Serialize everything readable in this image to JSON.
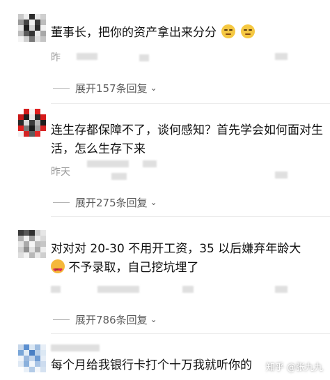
{
  "comments": [
    {
      "text": "董事长，把你的资产拿出来分分",
      "time": "昨",
      "replies_label": "展开157条回复",
      "avatar_colors": [
        "#c9c9c9",
        "#eeeeee",
        "#2c2c2c",
        "#e8e8e8",
        "#cfcfcf",
        "#9a9a9a",
        "#444444",
        "#f0f0f0",
        "#3a3a3a",
        "#bdbdbd",
        "#e5e5e5",
        "#1f1f1f",
        "#d6d6d6",
        "#2a2a2a",
        "#f2f2f2",
        "#bcbcbc",
        "#5a5a5a",
        "#333333",
        "#e9e9e9",
        "#a8a8a8",
        "#f4f4f4",
        "#cfcfcf",
        "#777777",
        "#dedede",
        "#c4c4c4"
      ]
    },
    {
      "text": "连生存都保障不了，谈何感知？首先学会如何面对生活，怎么生存下来",
      "time": "昨天",
      "replies_label": "展开275条回复",
      "avatar_colors": [
        "#ffffff",
        "#d41c1c",
        "#f3f3f3",
        "#e02020",
        "#ffffff",
        "#c71818",
        "#1e1e1e",
        "#e8e8e8",
        "#2a2a2a",
        "#d61a1a",
        "#2b2b2b",
        "#dadada",
        "#3b3b3b",
        "#b5b5b5",
        "#1f1f1f",
        "#e01f1f",
        "#7a7a7a",
        "#1a1a1a",
        "#9d9d9d",
        "#d92525",
        "#f2f2f2",
        "#d32424",
        "#5d5d5d",
        "#e42a2a",
        "#ffffff"
      ]
    },
    {
      "text_line1": "对对对 20-30 不用开工资，35 以后嫌弃年龄大",
      "text_line2": "不予录取，自己挖坑埋了",
      "time": "",
      "replies_label": "展开786条回复",
      "avatar_colors": [
        "#3a3a3a",
        "#595959",
        "#2f2f2f",
        "#cccccc",
        "#e6e6e6",
        "#b3b3b3",
        "#f0f0f0",
        "#9c9c9c",
        "#ededed",
        "#d9d9d9",
        "#e4e4e4",
        "#aaaaaa",
        "#f5f5f5",
        "#bdbdbd",
        "#c6c6c6",
        "#d0d0d0",
        "#8f8f8f",
        "#e2e2e2",
        "#a7a7a7",
        "#eeeeee",
        "#dedede",
        "#f2f2f2",
        "#b8b8b8",
        "#e9e9e9",
        "#cfcfcf"
      ]
    },
    {
      "text": "每个月给我银行卡打个十万我就听你的",
      "avatar_colors": [
        "#c7d7ea",
        "#5b8fd0",
        "#d9e6f3",
        "#9fbde0",
        "#e8eff7",
        "#7aa6d8",
        "#e1ebf5",
        "#4a7fc4",
        "#b8cfe9",
        "#dce8f4",
        "#f0f4fa",
        "#9ab8de",
        "#c4d6ec",
        "#6f9cd4",
        "#e6eef7",
        "#dfe9f4",
        "#8ab0dc",
        "#f2f6fb",
        "#a9c4e5",
        "#cddcef",
        "#ffffff",
        "#e9f0f8",
        "#b3cbe7",
        "#f4f7fb",
        "#d5e2f1"
      ]
    }
  ],
  "watermark": "知乎 @张九九"
}
